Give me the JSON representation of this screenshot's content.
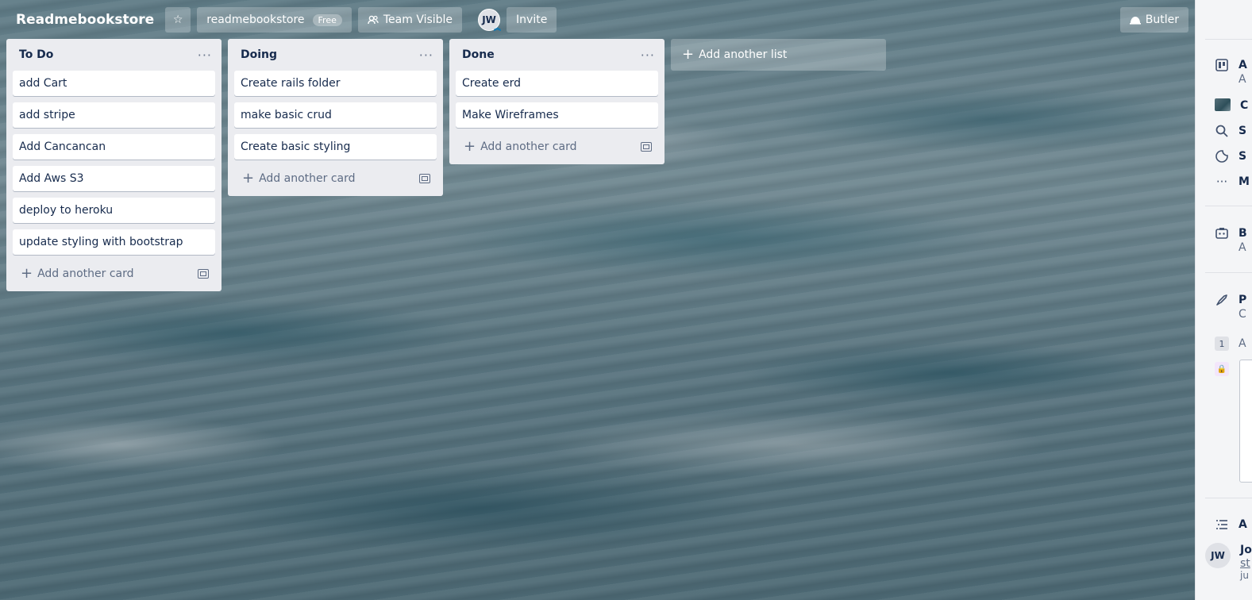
{
  "header": {
    "board_title": "Readmebookstore",
    "workspace_name": "readmebookstore",
    "workspace_badge": "Free",
    "visibility_label": "Team Visible",
    "member_initials": "JW",
    "invite_label": "Invite",
    "butler_label": "Butler"
  },
  "lists": [
    {
      "title": "To Do",
      "cards": [
        "add Cart",
        "add stripe",
        "Add Cancancan",
        "Add Aws S3",
        "deploy to heroku",
        "update styling with bootstrap"
      ],
      "add_card_label": "Add another card"
    },
    {
      "title": "Doing",
      "cards": [
        "Create rails folder",
        "make basic crud",
        "Create basic styling"
      ],
      "add_card_label": "Add another card"
    },
    {
      "title": "Done",
      "cards": [
        "Create erd",
        "Make Wireframes"
      ],
      "add_card_label": "Add another card"
    }
  ],
  "add_list_label": "Add another list",
  "sidebar": {
    "items": [
      {
        "icon": "board-icon",
        "label": "A",
        "sub": "A"
      },
      {
        "icon": "background-thumbnail",
        "label": "C"
      },
      {
        "icon": "search-icon",
        "label": "S"
      },
      {
        "icon": "sticker-icon",
        "label": "S"
      },
      {
        "icon": "more-icon",
        "label": "M"
      },
      {
        "icon": "butler-icon",
        "label": "B",
        "sub": "A"
      },
      {
        "icon": "power-up-icon",
        "label": "P",
        "sub": "C"
      }
    ],
    "count_badge": "1",
    "count_text": "A",
    "activity_label": "A",
    "activity_user_initials": "JW",
    "activity_user_name": "Jo",
    "activity_link": "st",
    "activity_time": "ju"
  },
  "colors": {
    "list_bg": "#ebecf0",
    "header_button_bg": "rgba(255,255,255,0.24)",
    "sidebar_bg": "#f4f5f7"
  }
}
